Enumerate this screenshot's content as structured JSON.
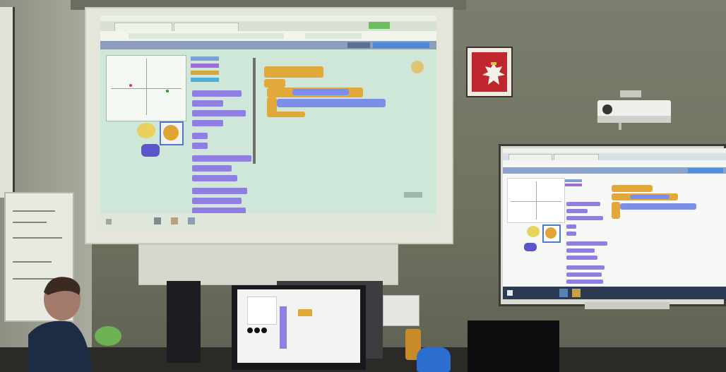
{
  "scene": {
    "description_colors": {
      "scratch_purple": "#8f7fe0",
      "scratch_yellow": "#e3a83a",
      "scratch_blue": "#7c8ee8",
      "emblem_red": "#c0262d"
    }
  },
  "projected_screen": {
    "browser_tabs": [
      "",
      ""
    ],
    "app": "scratch"
  },
  "smartboard": {
    "browser_tabs": [
      "",
      ""
    ],
    "app": "scratch"
  },
  "emblem": {
    "icon": "polish-eagle-icon"
  },
  "icons": [
    "projector-icon",
    "robot-toy-icon",
    "monitor-icon"
  ]
}
